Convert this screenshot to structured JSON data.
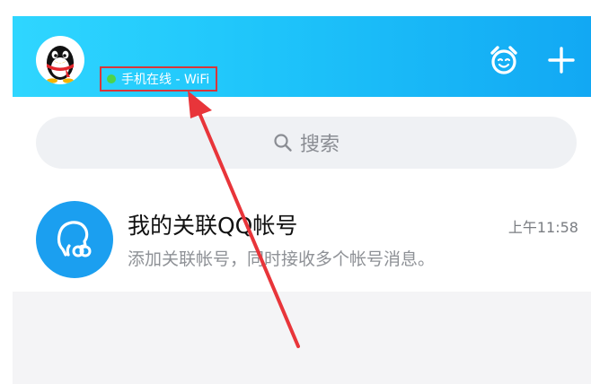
{
  "header": {
    "status_text": "手机在线 - WiFi",
    "status_color": "#4ed34a",
    "avatar_icon": "penguin-icon",
    "right_icons": [
      "alarm-face-icon",
      "plus-icon"
    ]
  },
  "search": {
    "placeholder": "搜索",
    "icon": "search-icon"
  },
  "conversations": [
    {
      "title": "我的关联QQ帐号",
      "time": "上午11:58",
      "preview": "添加关联帐号，同时接收多个帐号消息。",
      "icon": "linked-account-icon"
    }
  ],
  "annotation": {
    "type": "arrow",
    "color": "#e8353a"
  },
  "colors": {
    "header_start": "#2fd6ff",
    "header_end": "#12a8f3",
    "accent_blue": "#1b9ff0",
    "highlight_red": "#d8363a"
  }
}
